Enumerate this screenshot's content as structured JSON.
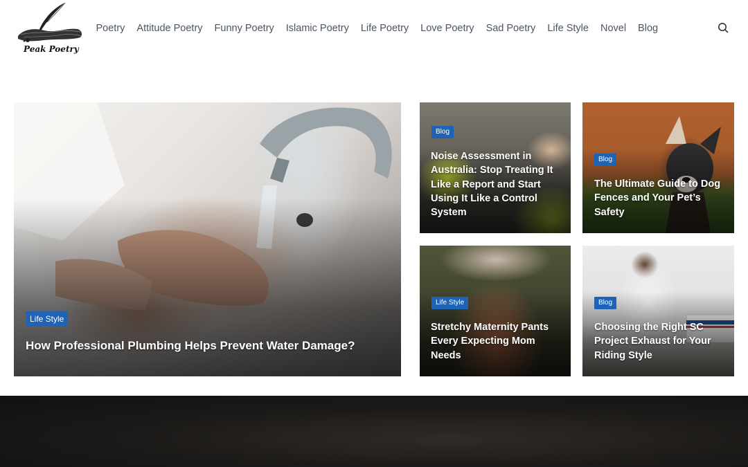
{
  "site": {
    "logo_text": "Peak Poetry"
  },
  "nav": {
    "items": [
      {
        "label": "Poetry"
      },
      {
        "label": "Attitude Poetry"
      },
      {
        "label": "Funny Poetry"
      },
      {
        "label": "Islamic Poetry"
      },
      {
        "label": "Life Poetry"
      },
      {
        "label": "Love Poetry"
      },
      {
        "label": "Sad Poetry"
      },
      {
        "label": "Life Style"
      },
      {
        "label": "Novel"
      },
      {
        "label": "Blog"
      }
    ],
    "search_icon": "search-icon"
  },
  "featured": {
    "category": "Life Style",
    "title": "How Professional Plumbing Helps Prevent Water Damage?"
  },
  "posts": [
    {
      "category": "Blog",
      "title": "Noise Assessment in Australia: Stop Treating It Like a Report and Start Using It Like a Control System"
    },
    {
      "category": "Blog",
      "title": "The Ultimate Guide to Dog Fences and Your Pet’s Safety"
    },
    {
      "category": "Life Style",
      "title": "Stretchy Maternity Pants Every Expecting Mom Needs"
    },
    {
      "category": "Blog",
      "title": "Choosing the Right SC Project Exhaust for Your Riding Style"
    }
  ],
  "colors": {
    "badge": "#1e63b5",
    "nav_text": "#4b5563"
  }
}
